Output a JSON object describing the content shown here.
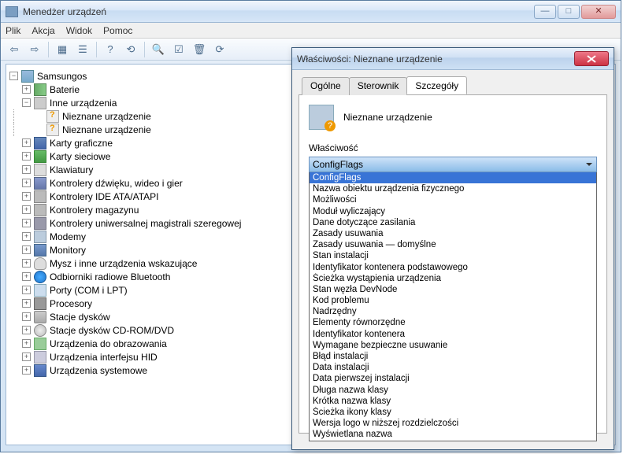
{
  "main": {
    "title": "Menedżer urządzeń",
    "menu": [
      "Plik",
      "Akcja",
      "Widok",
      "Pomoc"
    ]
  },
  "toolbar_icons": [
    "back",
    "forward",
    "sep",
    "show",
    "sep",
    "help",
    "refresh",
    "sep",
    "scan",
    "prop",
    "remove",
    "update"
  ],
  "tree": {
    "root": "Samsungos",
    "nodes": [
      {
        "label": "Baterie",
        "icon": "ic-battery",
        "exp": "+"
      },
      {
        "label": "Inne urządzenia",
        "icon": "ic-other",
        "exp": "-",
        "children": [
          {
            "label": "Nieznane urządzenie",
            "icon": "ic-unknown"
          },
          {
            "label": "Nieznane urządzenie",
            "icon": "ic-unknown"
          }
        ]
      },
      {
        "label": "Karty graficzne",
        "icon": "ic-display",
        "exp": "+"
      },
      {
        "label": "Karty sieciowe",
        "icon": "ic-net",
        "exp": "+"
      },
      {
        "label": "Klawiatury",
        "icon": "ic-keyb",
        "exp": "+"
      },
      {
        "label": "Kontrolery dźwięku, wideo i gier",
        "icon": "ic-sound",
        "exp": "+"
      },
      {
        "label": "Kontrolery IDE ATA/ATAPI",
        "icon": "ic-ide",
        "exp": "+"
      },
      {
        "label": "Kontrolery magazynu",
        "icon": "ic-storage",
        "exp": "+"
      },
      {
        "label": "Kontrolery uniwersalnej magistrali szeregowej",
        "icon": "ic-usb",
        "exp": "+"
      },
      {
        "label": "Modemy",
        "icon": "ic-modem",
        "exp": "+"
      },
      {
        "label": "Monitory",
        "icon": "ic-monitor",
        "exp": "+"
      },
      {
        "label": "Mysz i inne urządzenia wskazujące",
        "icon": "ic-mouse",
        "exp": "+"
      },
      {
        "label": "Odbiorniki radiowe Bluetooth",
        "icon": "ic-bt",
        "exp": "+"
      },
      {
        "label": "Porty (COM i LPT)",
        "icon": "ic-port",
        "exp": "+"
      },
      {
        "label": "Procesory",
        "icon": "ic-cpu",
        "exp": "+"
      },
      {
        "label": "Stacje dysków",
        "icon": "ic-disk",
        "exp": "+"
      },
      {
        "label": "Stacje dysków CD-ROM/DVD",
        "icon": "ic-cd",
        "exp": "+"
      },
      {
        "label": "Urządzenia do obrazowania",
        "icon": "ic-img",
        "exp": "+"
      },
      {
        "label": "Urządzenia interfejsu HID",
        "icon": "ic-hid",
        "exp": "+"
      },
      {
        "label": "Urządzenia systemowe",
        "icon": "ic-sys",
        "exp": "+"
      }
    ]
  },
  "dialog": {
    "title": "Właściwości: Nieznane urządzenie",
    "tabs": [
      "Ogólne",
      "Sterownik",
      "Szczegóły"
    ],
    "active_tab": 2,
    "device_name": "Nieznane urządzenie",
    "prop_label": "Właściwość",
    "combo_value": "ConfigFlags",
    "options": [
      "ConfigFlags",
      "Nazwa obiektu urządzenia fizycznego",
      "Możliwości",
      "Moduł wyliczający",
      "Dane dotyczące zasilania",
      "Zasady usuwania",
      "Zasady usuwania — domyślne",
      "Stan instalacji",
      "Identyfikator kontenera podstawowego",
      "Ścieżka wystąpienia urządzenia",
      "Stan węzła DevNode",
      "Kod problemu",
      "Nadrzędny",
      "Elementy równorzędne",
      "Identyfikator kontenera",
      "Wymagane bezpieczne usuwanie",
      "Błąd instalacji",
      "Data instalacji",
      "Data pierwszej instalacji",
      "Długa nazwa klasy",
      "Krótka nazwa klasy",
      "Ścieżka ikony klasy",
      "Wersja logo w niższej rozdzielczości",
      "Wyświetlana nazwa"
    ],
    "selected_option": 0
  }
}
